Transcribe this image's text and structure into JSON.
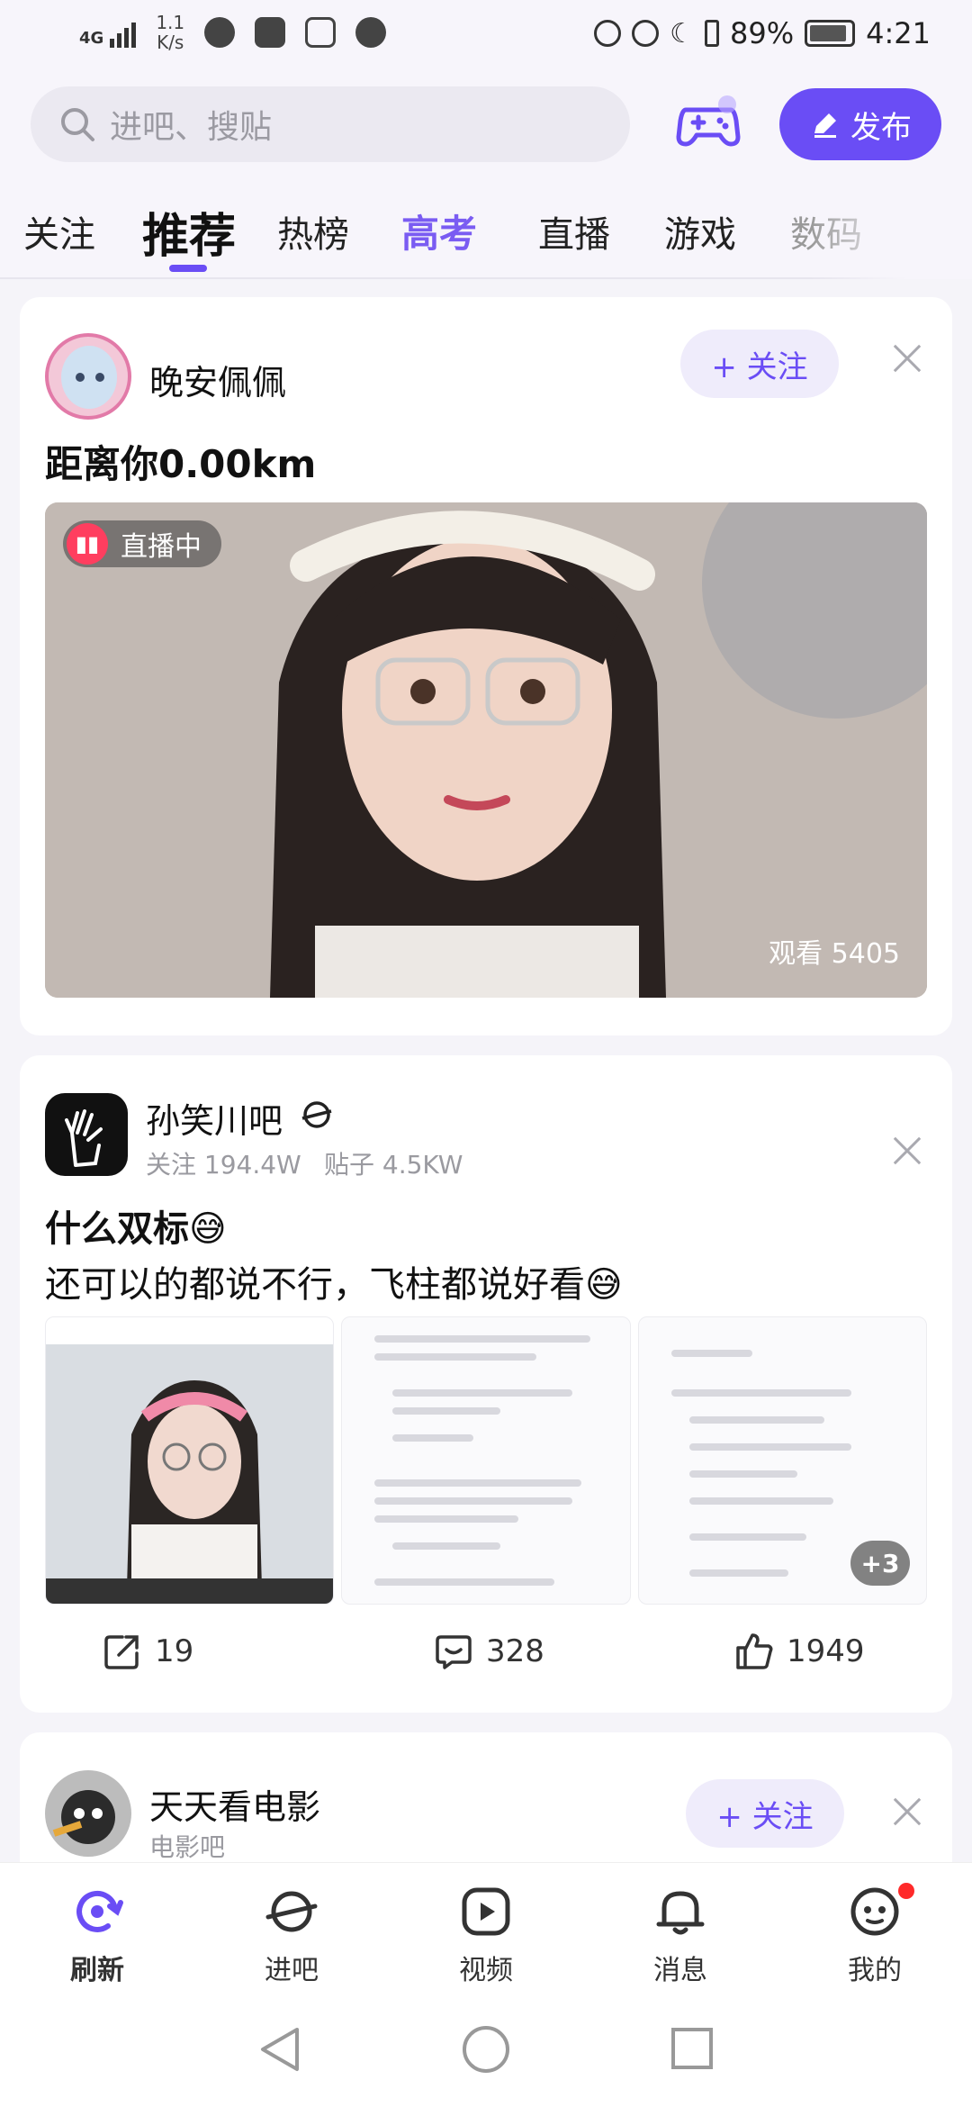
{
  "status_bar": {
    "network": "4G",
    "speed_value": "1.1",
    "speed_unit": "K/s",
    "battery": "89%",
    "time": "4:21"
  },
  "header": {
    "search_placeholder": "进吧、搜贴",
    "publish_label": "发布"
  },
  "tabs": [
    "关注",
    "推荐",
    "热榜",
    "高考",
    "直播",
    "游戏",
    "数码"
  ],
  "active_tab": "推荐",
  "cards": {
    "live": {
      "username": "晚安佩佩",
      "follow_label": "+ 关注",
      "title": "距离你0.00km",
      "badge": "直播中",
      "viewers": "观看 5405"
    },
    "post": {
      "username": "孙笑川吧",
      "followers": "关注 194.4W",
      "posts": "贴子 4.5KW",
      "title": "什么双标😅",
      "body": "还可以的都说不行，飞柱都说好看😅",
      "more_images": "+3",
      "shares": "19",
      "comments": "328",
      "likes": "1949"
    },
    "next": {
      "username": "天天看电影",
      "sub": "电影吧",
      "follow_label": "+ 关注"
    }
  },
  "bottom_nav": {
    "refresh": "刷新",
    "enter": "进吧",
    "video": "视频",
    "messages": "消息",
    "mine": "我的"
  },
  "colors": {
    "accent": "#6a4df5",
    "live_red": "#ff3e5f",
    "notification": "#ff2a2a"
  }
}
